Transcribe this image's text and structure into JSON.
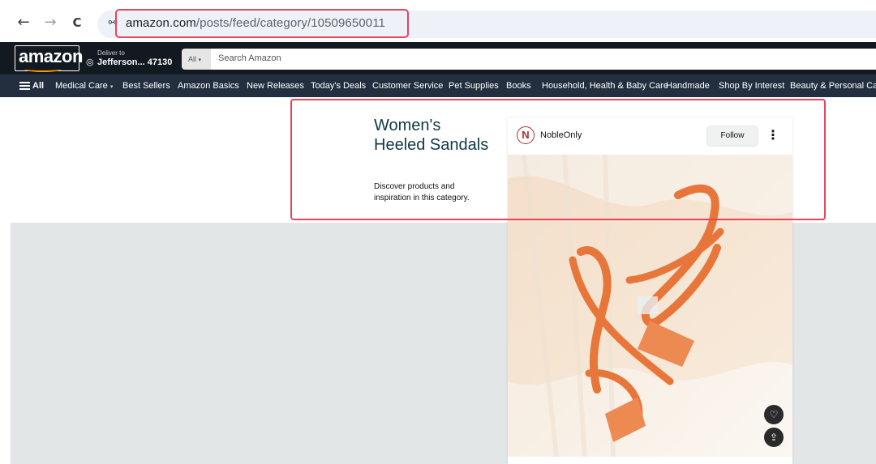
{
  "browser": {
    "back_icon": "←",
    "forward_icon": "→",
    "reload_icon": "C",
    "site_info_icon": "⚯",
    "url_host": "amazon.com",
    "url_path": "/posts/feed/category/10509650011"
  },
  "amazon": {
    "logo": "amazon",
    "deliver_label": "Deliver to",
    "deliver_location": "Jefferson... 47130",
    "search_dept": "All",
    "search_placeholder": "Search Amazon",
    "nav_all": "All",
    "nav_items": [
      "Medical Care",
      "Best Sellers",
      "Amazon Basics",
      "New Releases",
      "Today's Deals",
      "Customer Service",
      "Pet Supplies",
      "Books",
      "Household, Health & Baby Care",
      "Handmade",
      "Shop By Interest",
      "Beauty & Personal Ca"
    ]
  },
  "category": {
    "title": "Women's Heeled Sandals",
    "description": "Discover products and inspiration in this category."
  },
  "post": {
    "brand_initial": "N",
    "brand_name": "NobleOnly",
    "follow_label": "Follow",
    "more_icon": "⋮",
    "like_icon": "♡",
    "share_icon": "⇪"
  },
  "colors": {
    "highlight": "#e8445a",
    "amazon_dark": "#131921",
    "amazon_sub": "#232f3e",
    "accent_orange": "#ff9900",
    "sandal": "#e8763a"
  }
}
